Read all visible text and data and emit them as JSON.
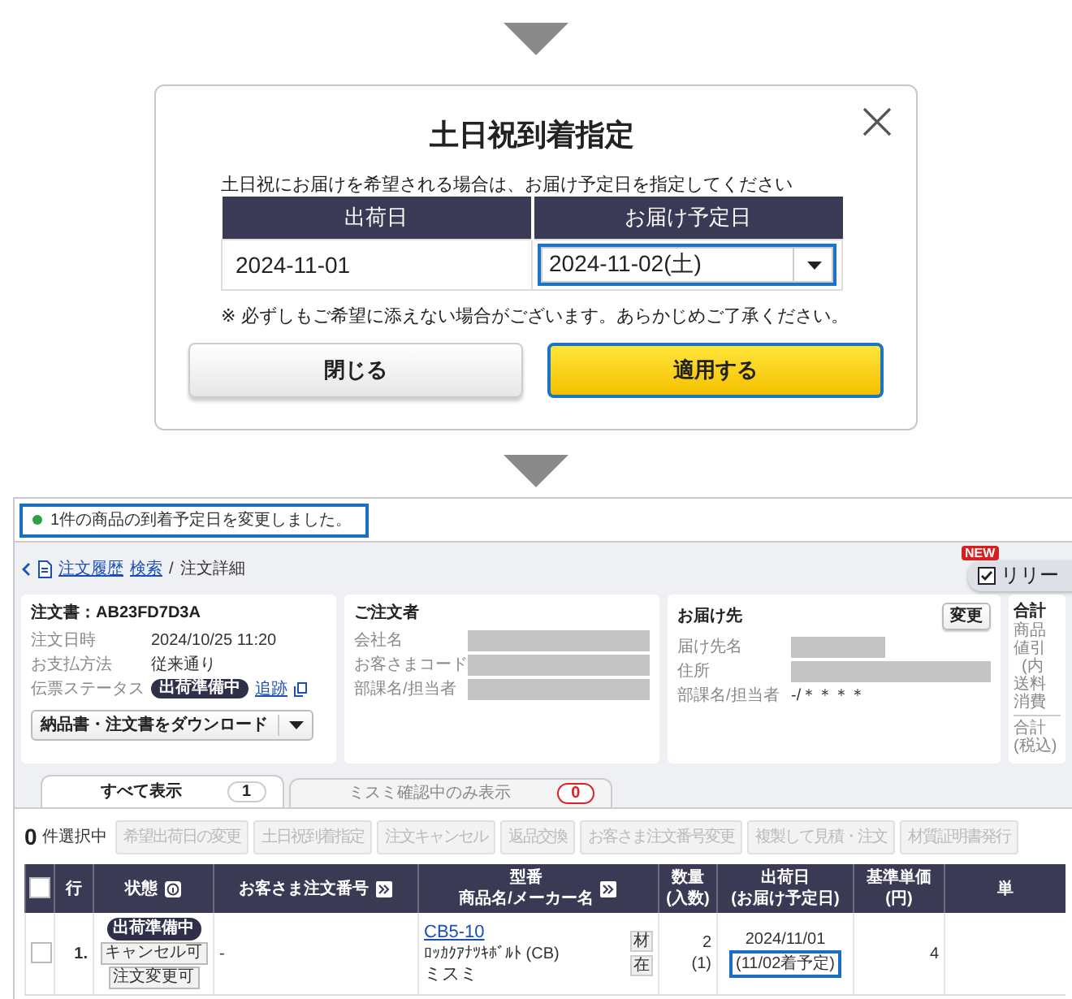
{
  "dialog": {
    "title": "土日祝到着指定",
    "instruction": "土日祝にお届けを希望される場合は、お届け予定日を指定してください",
    "columns": [
      "出荷日",
      "お届け予定日"
    ],
    "ship_date": "2024-11-01",
    "delivery_select": {
      "value": "2024-11-02(土)",
      "highlighted": true
    },
    "note": "※ 必ずしもご希望に添えない場合がございます。あらかじめご了承ください。",
    "buttons": [
      {
        "label": "閉じる",
        "kind": "secondary",
        "highlighted": false
      },
      {
        "label": "適用する",
        "kind": "primary",
        "highlighted": true
      }
    ]
  },
  "order_page": {
    "notice": {
      "text": "1件の商品の到着予定日を変更しました。",
      "highlighted": true
    },
    "breadcrumb": {
      "link": "注文履歴",
      "sublink": "検索",
      "separator": "/",
      "current": "注文詳細"
    },
    "release_button": {
      "badge": "NEW",
      "label": "リリー"
    },
    "order_card": {
      "title": "注文書：AB23FD7D3A",
      "fields": [
        {
          "label": "注文日時",
          "value": "2024/10/25 11:20"
        },
        {
          "label": "お支払方法",
          "value": "従来通り"
        }
      ],
      "status": {
        "label": "伝票ステータス",
        "badge": "出荷準備中",
        "link": "追跡"
      },
      "download_button": "納品書・注文書をダウンロード"
    },
    "customer_card": {
      "title": "ご注文者",
      "fields": [
        {
          "label": "会社名",
          "masked": true
        },
        {
          "label": "お客さまコード",
          "masked": true
        },
        {
          "label": "部課名/担当者",
          "masked": true
        }
      ]
    },
    "delivery_card": {
      "title": "お届け先",
      "change_button": "変更",
      "fields": [
        {
          "label": "届け先名",
          "masked": true
        },
        {
          "label": "住所",
          "masked": true
        },
        {
          "label": "部課名/担当者",
          "masked": false,
          "value": "-/＊＊＊＊"
        }
      ]
    },
    "totals_card": {
      "title": "合計",
      "labels": [
        "商品",
        "値引",
        "(内",
        "送料",
        "消費"
      ],
      "total_labels": [
        "合計",
        "(税込)"
      ]
    },
    "tabs": [
      {
        "label": "すべて表示",
        "count": "1",
        "kind": "all",
        "selected": true
      },
      {
        "label": "ミスミ確認中のみ表示",
        "count": "0",
        "kind": "review",
        "selected": false
      }
    ],
    "selection": {
      "count": "0",
      "label": "件選択中"
    },
    "actions": [
      {
        "label": "希望出荷日の変更",
        "disabled": true
      },
      {
        "label": "土日祝到着指定",
        "disabled": true
      },
      {
        "label": "注文キャンセル",
        "disabled": true
      },
      {
        "label": "返品交換",
        "disabled": true
      },
      {
        "label": "お客さま注文番号変更",
        "disabled": true
      },
      {
        "label": "複製して見積・注文",
        "disabled": true
      },
      {
        "label": "材質証明書発行",
        "disabled": true
      }
    ],
    "table": {
      "columns": [
        {
          "kind": "checkbox",
          "checked": false
        },
        {
          "kind": "text",
          "label": "行"
        },
        {
          "kind": "text",
          "label": "状態",
          "info_button": true
        },
        {
          "kind": "text",
          "label": "お客さま注文番号",
          "expand_button": true
        },
        {
          "kind": "text",
          "label": "型番",
          "sub": "商品名/メーカー名",
          "expand_button": true
        },
        {
          "kind": "text",
          "label": "数量",
          "sub": "(入数)"
        },
        {
          "kind": "text",
          "label": "出荷日",
          "sub": "(お届け予定日)"
        },
        {
          "kind": "text",
          "label": "基準単価",
          "sub": "(円)"
        },
        {
          "kind": "text",
          "label": "単"
        }
      ],
      "rows": [
        {
          "checked": false,
          "index": "1.",
          "badges": [
            {
              "label": "出荷準備中",
              "kind": "status"
            },
            {
              "label": "キャンセル可",
              "kind": "tag"
            },
            {
              "label": "注文変更可",
              "kind": "tag"
            }
          ],
          "customer_order_no": "-",
          "part_number": "CB5-10",
          "product_name": "ﾛｯｶｸｱﾅﾂｷﾎﾞﾙﾄ (CB)",
          "maker": "ミスミ",
          "chips": [
            "材",
            "在"
          ],
          "quantity": "2",
          "pack": "(1)",
          "ship_date": "2024/11/01",
          "delivery": {
            "text": "(11/02着予定)",
            "highlighted": true
          },
          "base_price": "4"
        }
      ]
    }
  }
}
